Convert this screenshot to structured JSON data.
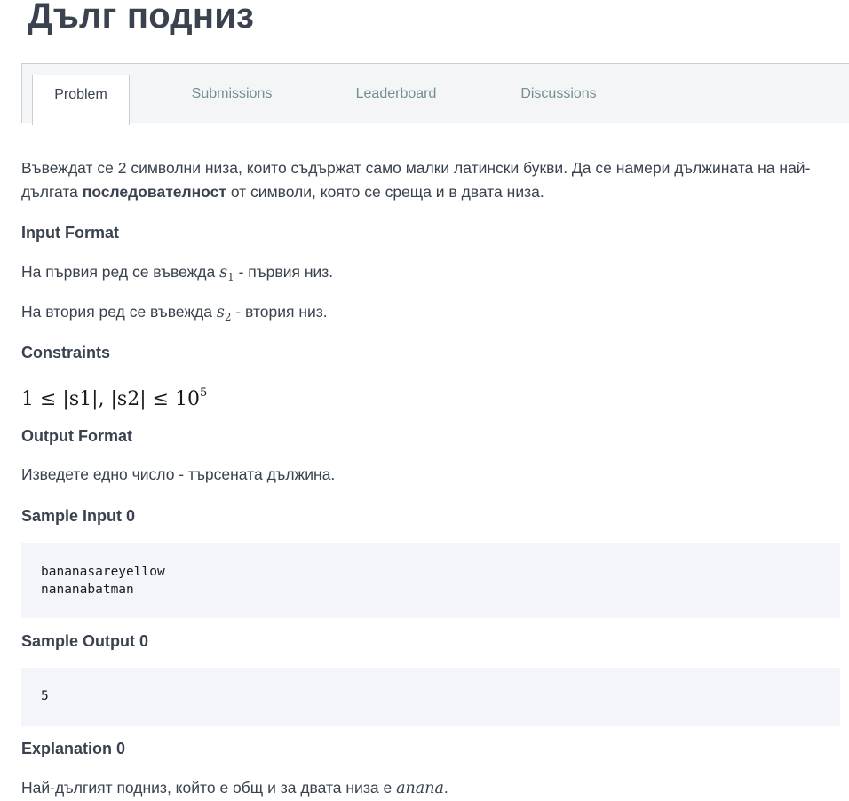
{
  "page": {
    "title": "Дълг подниз"
  },
  "tabs": [
    {
      "label": "Problem",
      "active": true
    },
    {
      "label": "Submissions",
      "active": false
    },
    {
      "label": "Leaderboard",
      "active": false
    },
    {
      "label": "Discussions",
      "active": false
    }
  ],
  "problem": {
    "intro_part1": "Въвеждат се 2 символни низа, които съдържат само малки латински букви. Да се намери дължината на най-дългата ",
    "intro_bold": "последователност",
    "intro_part2": " от символи, която се среща и в двата низа.",
    "input_format_heading": "Input Format",
    "input_line1_prefix": "На първия ред се въвежда ",
    "input_line1_var": "s",
    "input_line1_sub": "1",
    "input_line1_suffix": " - първия низ.",
    "input_line2_prefix": "На втория ред се въвежда ",
    "input_line2_var": "s",
    "input_line2_sub": "2",
    "input_line2_suffix": " - втория низ.",
    "constraints_heading": "Constraints",
    "constraint_text": "1 ≤ |s1|, |s2| ≤ 10",
    "constraint_exp": "5",
    "output_format_heading": "Output Format",
    "output_format_text": "Изведете едно число - търсената дължина.",
    "sample_input_heading": "Sample Input 0",
    "sample_input_lines": [
      "bananasareyellow",
      "nananabatman"
    ],
    "sample_output_heading": "Sample Output 0",
    "sample_output_lines": [
      "5"
    ],
    "explanation_heading": "Explanation 0",
    "explanation_prefix": "Най-дългият подниз, който е общ и за двата низа е ",
    "explanation_math": "anana",
    "explanation_suffix": "."
  }
}
